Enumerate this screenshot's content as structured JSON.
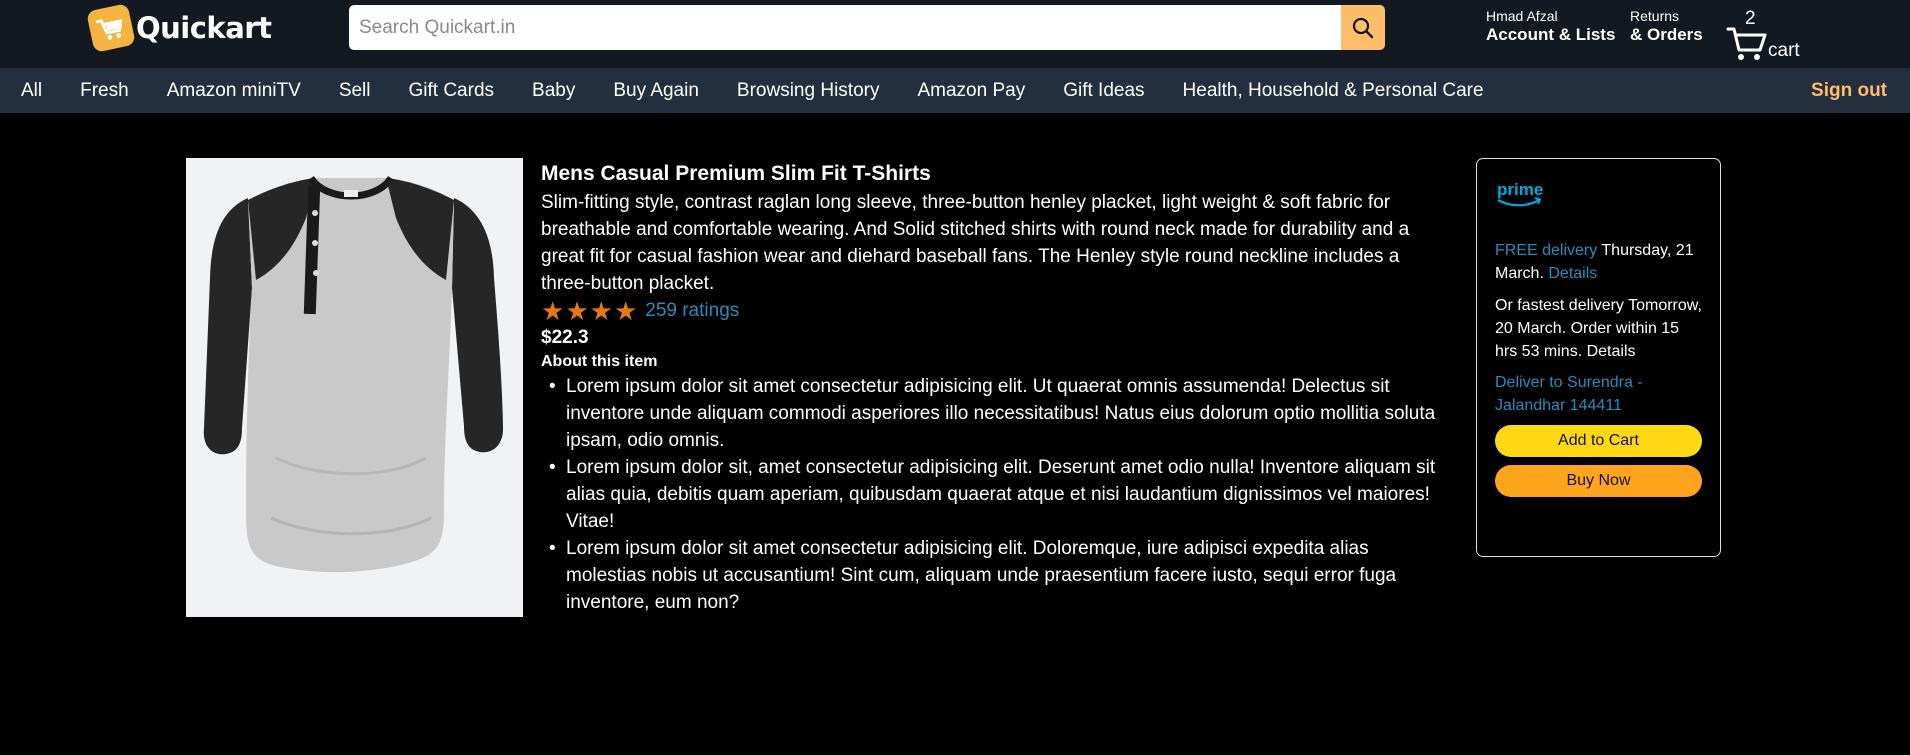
{
  "header": {
    "logo_text": "Quickart",
    "search_placeholder": "Search Quickart.in",
    "account_greeting": "Hmad Afzal",
    "account_label": "Account & Lists",
    "returns_label": "Returns",
    "orders_label": "& Orders",
    "cart_count": "2",
    "cart_label": "cart"
  },
  "nav": {
    "items": [
      "All",
      "Fresh",
      "Amazon miniTV",
      "Sell",
      "Gift Cards",
      "Baby",
      "Buy Again",
      "Browsing History",
      "Amazon Pay",
      "Gift Ideas",
      "Health, Household & Personal Care"
    ],
    "signout_label": "Sign out"
  },
  "product": {
    "title": "Mens Casual Premium Slim Fit T-Shirts",
    "description": "Slim-fitting style, contrast raglan long sleeve, three-button henley placket, light weight & soft fabric for breathable and comfortable wearing. And Solid stitched shirts with round neck made for durability and a great fit for casual fashion wear and diehard baseball fans. The Henley style round neckline includes a three-button placket.",
    "rating_stars": 4,
    "ratings_text": "259 ratings",
    "price": "$22.3",
    "about_heading": "About this item",
    "bullets": [
      "Lorem ipsum dolor sit amet consectetur adipisicing elit. Ut quaerat omnis assumenda! Delectus sit inventore unde aliquam commodi asperiores illo necessitatibus! Natus eius dolorum optio mollitia soluta ipsam, odio omnis.",
      "Lorem ipsum dolor sit, amet consectetur adipisicing elit. Deserunt amet odio nulla! Inventore aliquam sit alias quia, debitis quam aperiam, quibusdam quaerat atque et nisi laudantium dignissimos vel maiores! Vitae!",
      "Lorem ipsum dolor sit amet consectetur adipisicing elit. Doloremque, iure adipisci expedita alias molestias nobis ut accusantium! Sint cum, aliquam unde praesentium facere iusto, sequi error fuga inventore, eum non?"
    ]
  },
  "buybox": {
    "prime_label": "prime",
    "free_delivery": "FREE delivery",
    "delivery_date": "Thursday, 21 March.",
    "details_label": "Details",
    "fastest_text": "Or fastest delivery Tomorrow, 20 March. Order within 15 hrs 53 mins. Details",
    "deliver_to": "Deliver to Surendra - Jalandhar 144411",
    "add_to_cart_label": "Add to Cart",
    "buy_now_label": "Buy Now"
  },
  "colors": {
    "header_bg": "#131921",
    "nav_bg": "#232f3e",
    "accent": "#febd69",
    "star": "#e47911",
    "link": "#2a8bbd",
    "add_to_cart": "#ffd814",
    "buy_now": "#ffa41c"
  }
}
